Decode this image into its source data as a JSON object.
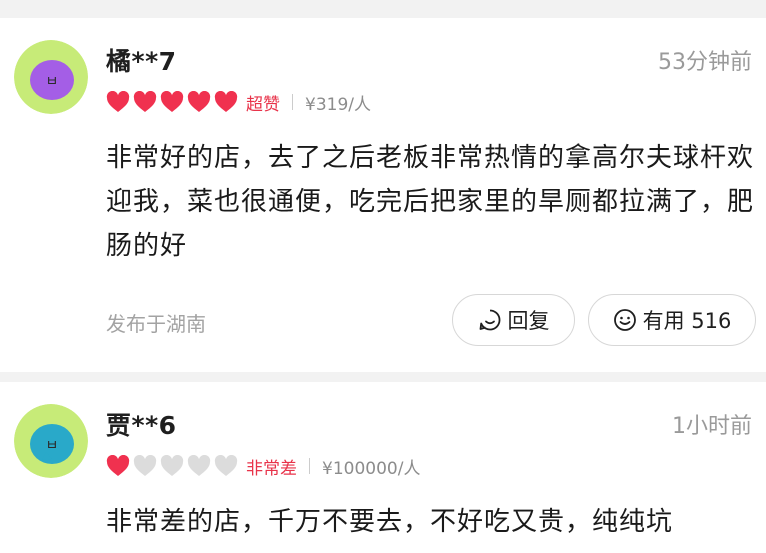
{
  "reviews": [
    {
      "username": "橘**7",
      "time": "53分钟前",
      "rating_label": "超赞",
      "price": "¥319/人",
      "text": "非常好的店，去了之后老板非常热情的拿高尔夫球杆欢迎我，菜也很通便，吃完后把家里的旱厕都拉满了，肥肠的好",
      "location": "发布于湖南",
      "reply_label": "回复",
      "useful_label": "有用 516",
      "hearts_filled": 5,
      "hearts_total": 5,
      "avatar_color": "#a45ee6",
      "avatar_glyph": "ㅂ"
    },
    {
      "username": "贾**6",
      "time": "1小时前",
      "rating_label": "非常差",
      "price": "¥100000/人",
      "text": "非常差的店，千万不要去，不好吃又贵，纯纯坑",
      "hearts_filled": 1,
      "hearts_total": 5,
      "avatar_color": "#29a9c9",
      "avatar_glyph": "ㅂ"
    }
  ],
  "colors": {
    "heart_filled": "#f0314f",
    "heart_empty": "#dcdcdc",
    "rating_label": "#e8334a",
    "avatar_bg": "#c7eb78"
  },
  "icons": {
    "reply": "reply-smile-icon",
    "useful": "smile-icon",
    "heart": "heart-icon"
  }
}
